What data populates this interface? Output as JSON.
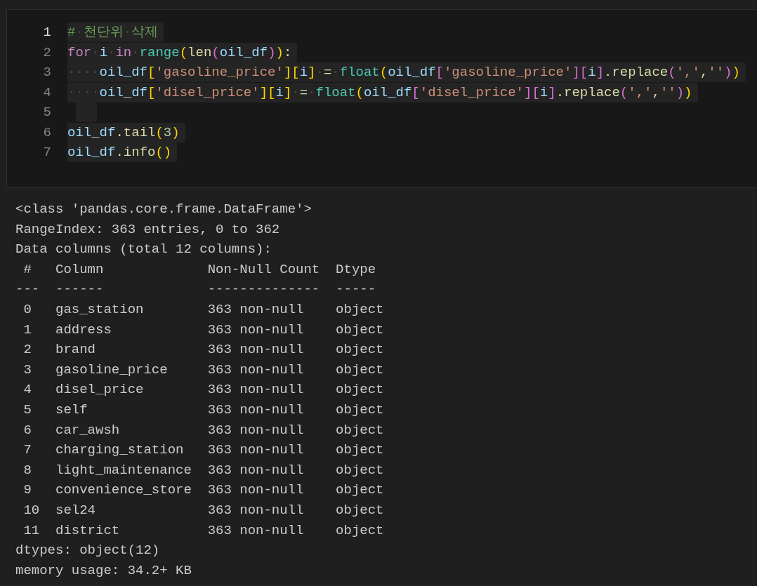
{
  "code_cell": {
    "lines": [
      {
        "number": "1",
        "active": true,
        "tokens": [
          {
            "kind": "comment",
            "text": "#"
          },
          {
            "kind": "ws",
            "text": "·"
          },
          {
            "kind": "comment",
            "text": "천단위"
          },
          {
            "kind": "ws",
            "text": "·"
          },
          {
            "kind": "comment",
            "text": "삭제"
          }
        ]
      },
      {
        "number": "2",
        "active": false,
        "tokens": [
          {
            "kind": "keyword",
            "text": "for"
          },
          {
            "kind": "ws",
            "text": "·"
          },
          {
            "kind": "var",
            "text": "i"
          },
          {
            "kind": "ws",
            "text": "·"
          },
          {
            "kind": "keyword",
            "text": "in"
          },
          {
            "kind": "ws",
            "text": "·"
          },
          {
            "kind": "func",
            "text": "range"
          },
          {
            "kind": "paren1",
            "text": "("
          },
          {
            "kind": "plain",
            "text": "len"
          },
          {
            "kind": "paren2",
            "text": "("
          },
          {
            "kind": "var",
            "text": "oil_df"
          },
          {
            "kind": "paren2",
            "text": ")"
          },
          {
            "kind": "paren1",
            "text": ")"
          },
          {
            "kind": "plain",
            "text": ":"
          }
        ]
      },
      {
        "number": "3",
        "active": false,
        "tokens": [
          {
            "kind": "ws",
            "text": "····"
          },
          {
            "kind": "var",
            "text": "oil_df"
          },
          {
            "kind": "paren1",
            "text": "["
          },
          {
            "kind": "string",
            "text": "'gasoline_price'"
          },
          {
            "kind": "paren1",
            "text": "]["
          },
          {
            "kind": "var",
            "text": "i"
          },
          {
            "kind": "paren1",
            "text": "]"
          },
          {
            "kind": "ws",
            "text": "·"
          },
          {
            "kind": "plain",
            "text": "="
          },
          {
            "kind": "ws",
            "text": "·"
          },
          {
            "kind": "func",
            "text": "float"
          },
          {
            "kind": "paren1",
            "text": "("
          },
          {
            "kind": "var",
            "text": "oil_df"
          },
          {
            "kind": "paren2",
            "text": "["
          },
          {
            "kind": "string",
            "text": "'gasoline_price'"
          },
          {
            "kind": "paren2",
            "text": "]["
          },
          {
            "kind": "var",
            "text": "i"
          },
          {
            "kind": "paren2",
            "text": "]"
          },
          {
            "kind": "plain",
            "text": ".replace"
          },
          {
            "kind": "paren2",
            "text": "("
          },
          {
            "kind": "string",
            "text": "','"
          },
          {
            "kind": "plain",
            "text": ","
          },
          {
            "kind": "string",
            "text": "''"
          },
          {
            "kind": "paren2",
            "text": ")"
          },
          {
            "kind": "paren1",
            "text": ")"
          }
        ]
      },
      {
        "number": "4",
        "active": false,
        "tokens": [
          {
            "kind": "ws",
            "text": "····"
          },
          {
            "kind": "var",
            "text": "oil_df"
          },
          {
            "kind": "paren1",
            "text": "["
          },
          {
            "kind": "string",
            "text": "'disel_price'"
          },
          {
            "kind": "paren1",
            "text": "]["
          },
          {
            "kind": "var",
            "text": "i"
          },
          {
            "kind": "paren1",
            "text": "]"
          },
          {
            "kind": "ws",
            "text": "·"
          },
          {
            "kind": "plain",
            "text": "="
          },
          {
            "kind": "ws",
            "text": "·"
          },
          {
            "kind": "func",
            "text": "float"
          },
          {
            "kind": "paren1",
            "text": "("
          },
          {
            "kind": "var",
            "text": "oil_df"
          },
          {
            "kind": "paren2",
            "text": "["
          },
          {
            "kind": "string",
            "text": "'disel_price'"
          },
          {
            "kind": "paren2",
            "text": "]["
          },
          {
            "kind": "var",
            "text": "i"
          },
          {
            "kind": "paren2",
            "text": "]"
          },
          {
            "kind": "plain",
            "text": ".replace"
          },
          {
            "kind": "paren2",
            "text": "("
          },
          {
            "kind": "string",
            "text": "','"
          },
          {
            "kind": "plain",
            "text": ","
          },
          {
            "kind": "string",
            "text": "''"
          },
          {
            "kind": "paren2",
            "text": ")"
          },
          {
            "kind": "paren1",
            "text": ")"
          }
        ]
      },
      {
        "number": "5",
        "active": false
      },
      {
        "number": "6",
        "active": false,
        "tokens": [
          {
            "kind": "var",
            "text": "oil_df"
          },
          {
            "kind": "plain",
            "text": ".tail"
          },
          {
            "kind": "paren1",
            "text": "("
          },
          {
            "kind": "number",
            "text": "3"
          },
          {
            "kind": "paren1",
            "text": ")"
          }
        ]
      },
      {
        "number": "7",
        "active": false,
        "tokens": [
          {
            "kind": "var",
            "text": "oil_df"
          },
          {
            "kind": "plain",
            "text": ".info"
          },
          {
            "kind": "paren1",
            "text": "()"
          }
        ]
      }
    ]
  },
  "output": {
    "lines": [
      "<class 'pandas.core.frame.DataFrame'>",
      "RangeIndex: 363 entries, 0 to 362",
      "Data columns (total 12 columns):",
      " #   Column             Non-Null Count  Dtype ",
      "---  ------             --------------  ----- ",
      " 0   gas_station        363 non-null    object",
      " 1   address            363 non-null    object",
      " 2   brand              363 non-null    object",
      " 3   gasoline_price     363 non-null    object",
      " 4   disel_price        363 non-null    object",
      " 5   self               363 non-null    object",
      " 6   car_awsh           363 non-null    object",
      " 7   charging_station   363 non-null    object",
      " 8   light_maintenance  363 non-null    object",
      " 9   convenience_store  363 non-null    object",
      " 10  sel24              363 non-null    object",
      " 11  district           363 non-null    object",
      "dtypes: object(12)",
      "memory usage: 34.2+ KB"
    ]
  }
}
